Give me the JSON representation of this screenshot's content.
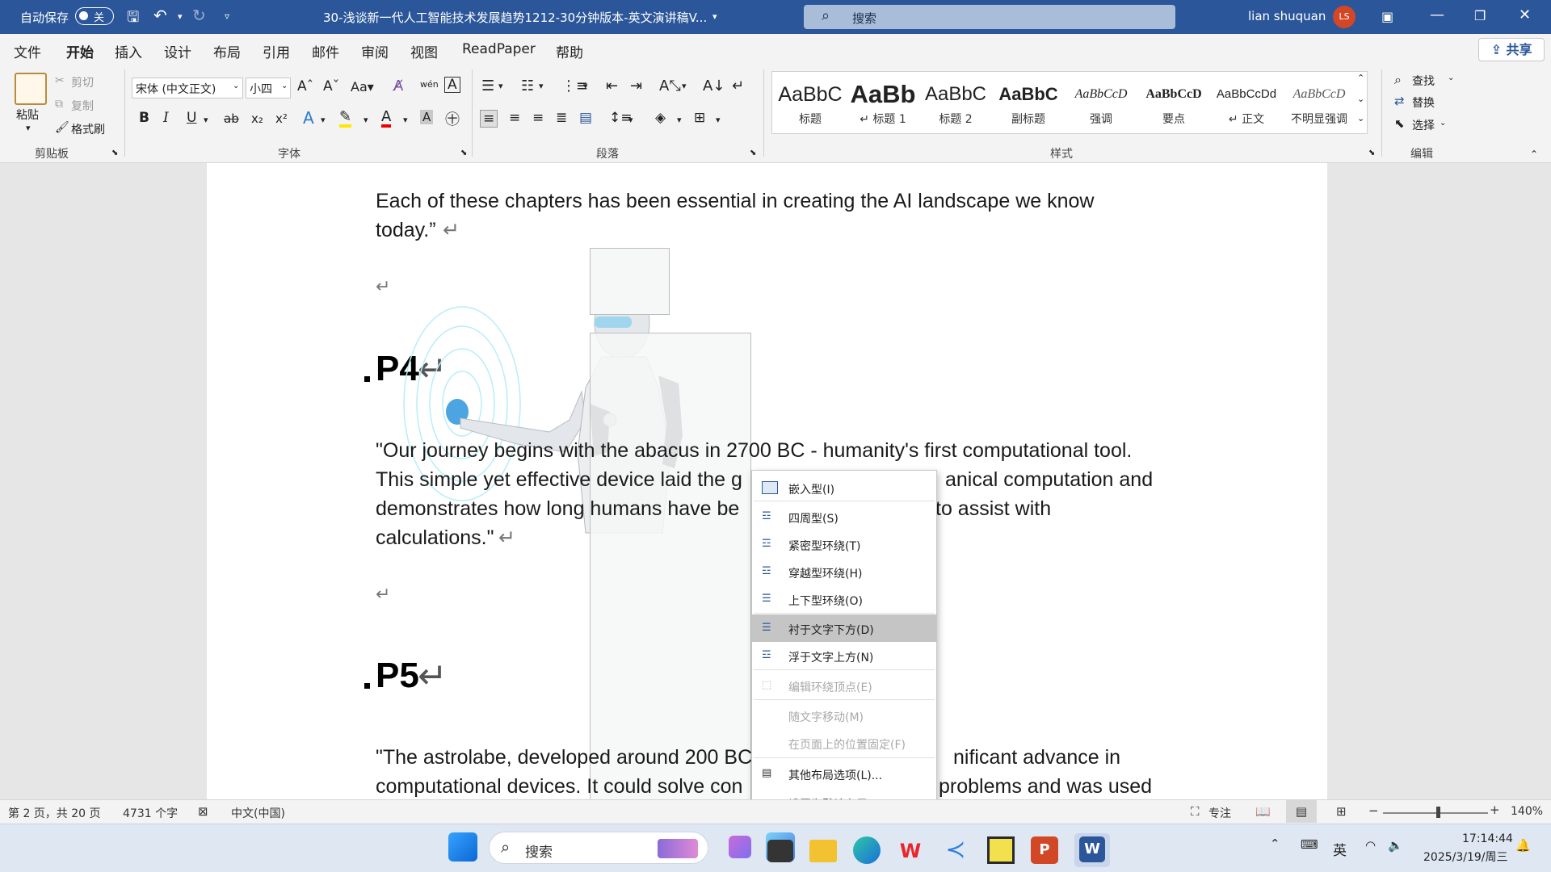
{
  "titlebar": {
    "autosave_label": "自动保存",
    "autosave_state": "关",
    "doc_title": "30-浅谈新一代人工智能技术发展趋势1212-30分钟版本-英文演讲稿V...",
    "search_placeholder": "搜索",
    "user_name": "lian shuquan",
    "user_initials": "LS"
  },
  "menu": {
    "items": [
      "文件",
      "开始",
      "插入",
      "设计",
      "布局",
      "引用",
      "邮件",
      "审阅",
      "视图",
      "ReadPaper",
      "帮助"
    ],
    "active": "开始",
    "share": "共享"
  },
  "ribbon": {
    "clipboard": {
      "paste": "粘贴",
      "cut": "剪切",
      "copy": "复制",
      "format_painter": "格式刷",
      "group": "剪贴板"
    },
    "font": {
      "name": "宋体 (中文正文)",
      "size": "小四",
      "group": "字体"
    },
    "paragraph": {
      "group": "段落"
    },
    "styles": {
      "group": "样式",
      "items": [
        {
          "preview": "AaBbC",
          "name": "标题"
        },
        {
          "preview": "AaBb",
          "name": "↵ 标题 1"
        },
        {
          "preview": "AaBbC",
          "name": "标题 2"
        },
        {
          "preview": "AaBbC",
          "name": "副标题"
        },
        {
          "preview": "AaBbCcD",
          "name": "强调"
        },
        {
          "preview": "AaBbCcD",
          "name": "要点"
        },
        {
          "preview": "AaBbCcDd",
          "name": "↵ 正文"
        },
        {
          "preview": "AaBbCcD",
          "name": "不明显强调"
        }
      ]
    },
    "editing": {
      "find": "查找",
      "replace": "替换",
      "select": "选择",
      "group": "编辑"
    }
  },
  "document": {
    "p_top_line1": "Each of these chapters has been essential in creating the AI landscape we know",
    "p_top_line2": "today.”",
    "heading_p4": "P4",
    "p4_line1": "\"Our journey begins with the abacus in 2700 BC - humanity's first computational tool.",
    "p4_line2": "This simple yet effective device laid the g",
    "p4_line2b": "anical computation and",
    "p4_line3": "demonstrates how long humans have be",
    "p4_line3b": "to assist with",
    "p4_line4": "calculations.\"",
    "heading_p5": "P5",
    "p5_line1": "\"The astrolabe, developed around 200 BC",
    "p5_line1b": "nificant advance in",
    "p5_line2": "computational devices. It could solve con",
    "p5_line2b": "problems and was used"
  },
  "context_menu": {
    "items": [
      {
        "label": "嵌入型(I)",
        "state": "normal"
      },
      {
        "label": "四周型(S)",
        "state": "normal"
      },
      {
        "label": "紧密型环绕(T)",
        "state": "normal"
      },
      {
        "label": "穿越型环绕(H)",
        "state": "normal"
      },
      {
        "label": "上下型环绕(O)",
        "state": "normal"
      },
      {
        "label": "衬于文字下方(D)",
        "state": "highlighted"
      },
      {
        "label": "浮于文字上方(N)",
        "state": "normal"
      },
      {
        "label": "编辑环绕顶点(E)",
        "state": "disabled"
      },
      {
        "label": "随文字移动(M)",
        "state": "disabled"
      },
      {
        "label": "在页面上的位置固定(F)",
        "state": "disabled"
      },
      {
        "label": "其他布局选项(L)...",
        "state": "normal"
      },
      {
        "label": "设置为默认布局(A)",
        "state": "normal"
      }
    ]
  },
  "statusbar": {
    "page": "第 2 页，共 20 页",
    "words": "4731 个字",
    "language": "中文(中国)",
    "focus": "专注",
    "zoom": "140%",
    "zoom_value": 140
  },
  "taskbar": {
    "search_placeholder": "搜索",
    "ime": "英",
    "time": "17:14:44",
    "date": "2025/3/19/周三"
  },
  "colors": {
    "accent": "#2b579a",
    "highlight_menu": "#c5c5c5"
  }
}
